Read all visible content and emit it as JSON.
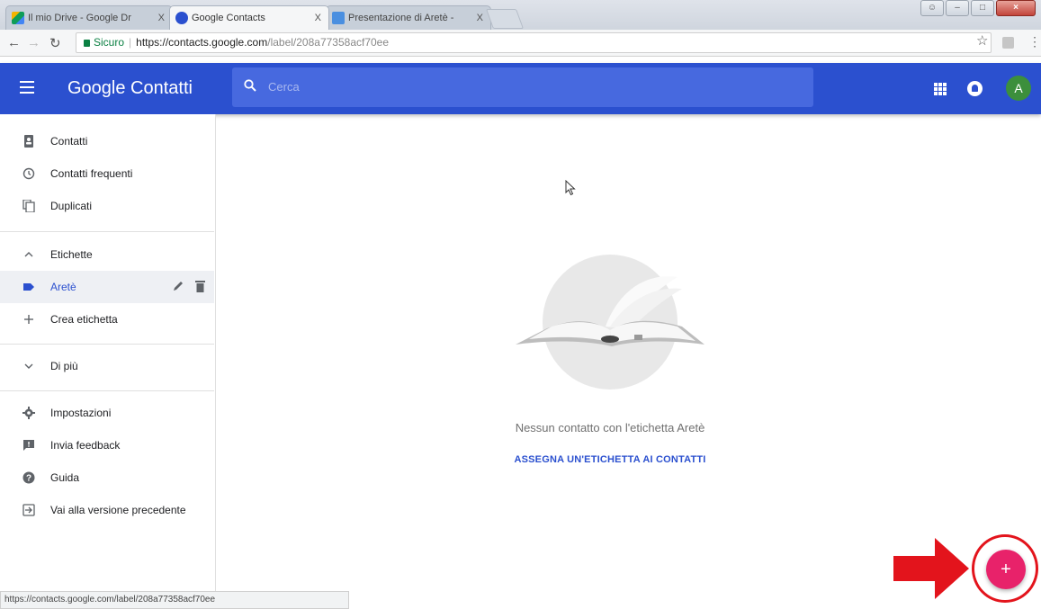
{
  "browser": {
    "tabs": [
      {
        "title": "Il mio Drive - Google Dr",
        "close": "X"
      },
      {
        "title": "Google Contacts",
        "close": "X"
      },
      {
        "title": "Presentazione di Aretè -",
        "close": "X"
      }
    ],
    "secure_label": "Sicuro",
    "url_host": "https://contacts.google.com",
    "url_path": "/label/208a77358acf70ee",
    "status_url": "https://contacts.google.com/label/208a77358acf70ee"
  },
  "header": {
    "title": "Google Contatti",
    "search_placeholder": "Cerca",
    "avatar_letter": "A"
  },
  "sidebar": {
    "items": [
      {
        "label": "Contatti",
        "icon": "contacts-icon"
      },
      {
        "label": "Contatti frequenti",
        "icon": "history-icon"
      },
      {
        "label": "Duplicati",
        "icon": "duplicates-icon"
      }
    ],
    "labels_section": "Etichette",
    "selected_label": "Aretè",
    "create_label": "Crea etichetta",
    "more": "Di più",
    "footer_items": [
      {
        "label": "Impostazioni",
        "icon": "gear-icon"
      },
      {
        "label": "Invia feedback",
        "icon": "feedback-icon"
      },
      {
        "label": "Guida",
        "icon": "help-icon"
      },
      {
        "label": "Vai alla versione precedente",
        "icon": "exit-icon"
      }
    ]
  },
  "main": {
    "empty_message": "Nessun contatto con l'etichetta Aretè",
    "assign_action": "ASSEGNA UN'ETICHETTA AI CONTATTI"
  },
  "fab": {
    "label": "+"
  },
  "colors": {
    "header": "#2b50cf",
    "fab": "#e8226a",
    "annotation": "#e3141c"
  }
}
